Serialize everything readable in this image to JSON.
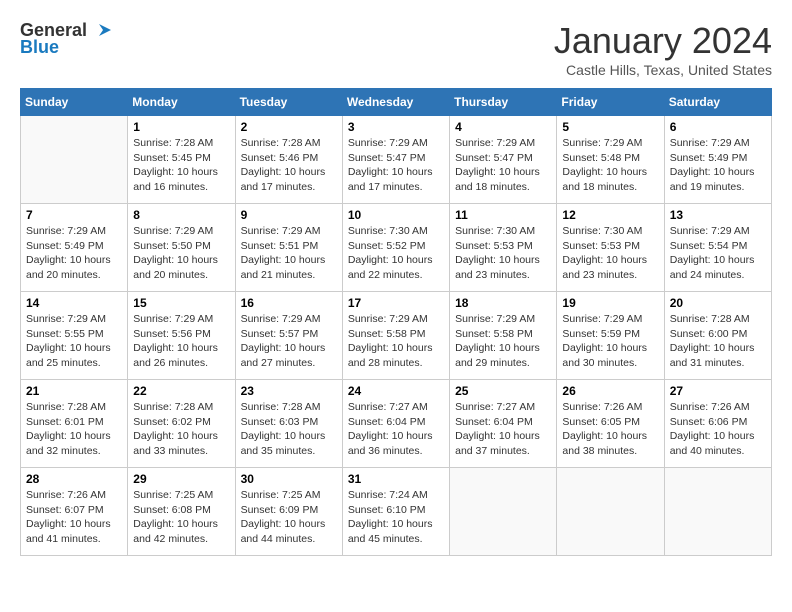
{
  "logo": {
    "line1": "General",
    "line2": "Blue"
  },
  "title": "January 2024",
  "location": "Castle Hills, Texas, United States",
  "weekdays": [
    "Sunday",
    "Monday",
    "Tuesday",
    "Wednesday",
    "Thursday",
    "Friday",
    "Saturday"
  ],
  "weeks": [
    [
      {
        "day": "",
        "info": ""
      },
      {
        "day": "1",
        "info": "Sunrise: 7:28 AM\nSunset: 5:45 PM\nDaylight: 10 hours\nand 16 minutes."
      },
      {
        "day": "2",
        "info": "Sunrise: 7:28 AM\nSunset: 5:46 PM\nDaylight: 10 hours\nand 17 minutes."
      },
      {
        "day": "3",
        "info": "Sunrise: 7:29 AM\nSunset: 5:47 PM\nDaylight: 10 hours\nand 17 minutes."
      },
      {
        "day": "4",
        "info": "Sunrise: 7:29 AM\nSunset: 5:47 PM\nDaylight: 10 hours\nand 18 minutes."
      },
      {
        "day": "5",
        "info": "Sunrise: 7:29 AM\nSunset: 5:48 PM\nDaylight: 10 hours\nand 18 minutes."
      },
      {
        "day": "6",
        "info": "Sunrise: 7:29 AM\nSunset: 5:49 PM\nDaylight: 10 hours\nand 19 minutes."
      }
    ],
    [
      {
        "day": "7",
        "info": "Sunrise: 7:29 AM\nSunset: 5:49 PM\nDaylight: 10 hours\nand 20 minutes."
      },
      {
        "day": "8",
        "info": "Sunrise: 7:29 AM\nSunset: 5:50 PM\nDaylight: 10 hours\nand 20 minutes."
      },
      {
        "day": "9",
        "info": "Sunrise: 7:29 AM\nSunset: 5:51 PM\nDaylight: 10 hours\nand 21 minutes."
      },
      {
        "day": "10",
        "info": "Sunrise: 7:30 AM\nSunset: 5:52 PM\nDaylight: 10 hours\nand 22 minutes."
      },
      {
        "day": "11",
        "info": "Sunrise: 7:30 AM\nSunset: 5:53 PM\nDaylight: 10 hours\nand 23 minutes."
      },
      {
        "day": "12",
        "info": "Sunrise: 7:30 AM\nSunset: 5:53 PM\nDaylight: 10 hours\nand 23 minutes."
      },
      {
        "day": "13",
        "info": "Sunrise: 7:29 AM\nSunset: 5:54 PM\nDaylight: 10 hours\nand 24 minutes."
      }
    ],
    [
      {
        "day": "14",
        "info": "Sunrise: 7:29 AM\nSunset: 5:55 PM\nDaylight: 10 hours\nand 25 minutes."
      },
      {
        "day": "15",
        "info": "Sunrise: 7:29 AM\nSunset: 5:56 PM\nDaylight: 10 hours\nand 26 minutes."
      },
      {
        "day": "16",
        "info": "Sunrise: 7:29 AM\nSunset: 5:57 PM\nDaylight: 10 hours\nand 27 minutes."
      },
      {
        "day": "17",
        "info": "Sunrise: 7:29 AM\nSunset: 5:58 PM\nDaylight: 10 hours\nand 28 minutes."
      },
      {
        "day": "18",
        "info": "Sunrise: 7:29 AM\nSunset: 5:58 PM\nDaylight: 10 hours\nand 29 minutes."
      },
      {
        "day": "19",
        "info": "Sunrise: 7:29 AM\nSunset: 5:59 PM\nDaylight: 10 hours\nand 30 minutes."
      },
      {
        "day": "20",
        "info": "Sunrise: 7:28 AM\nSunset: 6:00 PM\nDaylight: 10 hours\nand 31 minutes."
      }
    ],
    [
      {
        "day": "21",
        "info": "Sunrise: 7:28 AM\nSunset: 6:01 PM\nDaylight: 10 hours\nand 32 minutes."
      },
      {
        "day": "22",
        "info": "Sunrise: 7:28 AM\nSunset: 6:02 PM\nDaylight: 10 hours\nand 33 minutes."
      },
      {
        "day": "23",
        "info": "Sunrise: 7:28 AM\nSunset: 6:03 PM\nDaylight: 10 hours\nand 35 minutes."
      },
      {
        "day": "24",
        "info": "Sunrise: 7:27 AM\nSunset: 6:04 PM\nDaylight: 10 hours\nand 36 minutes."
      },
      {
        "day": "25",
        "info": "Sunrise: 7:27 AM\nSunset: 6:04 PM\nDaylight: 10 hours\nand 37 minutes."
      },
      {
        "day": "26",
        "info": "Sunrise: 7:26 AM\nSunset: 6:05 PM\nDaylight: 10 hours\nand 38 minutes."
      },
      {
        "day": "27",
        "info": "Sunrise: 7:26 AM\nSunset: 6:06 PM\nDaylight: 10 hours\nand 40 minutes."
      }
    ],
    [
      {
        "day": "28",
        "info": "Sunrise: 7:26 AM\nSunset: 6:07 PM\nDaylight: 10 hours\nand 41 minutes."
      },
      {
        "day": "29",
        "info": "Sunrise: 7:25 AM\nSunset: 6:08 PM\nDaylight: 10 hours\nand 42 minutes."
      },
      {
        "day": "30",
        "info": "Sunrise: 7:25 AM\nSunset: 6:09 PM\nDaylight: 10 hours\nand 44 minutes."
      },
      {
        "day": "31",
        "info": "Sunrise: 7:24 AM\nSunset: 6:10 PM\nDaylight: 10 hours\nand 45 minutes."
      },
      {
        "day": "",
        "info": ""
      },
      {
        "day": "",
        "info": ""
      },
      {
        "day": "",
        "info": ""
      }
    ]
  ]
}
